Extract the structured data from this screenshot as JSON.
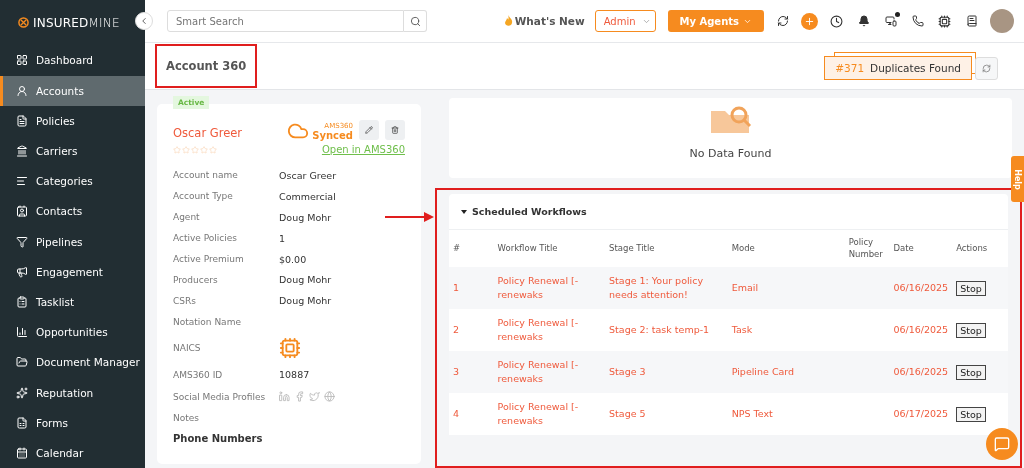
{
  "brand": {
    "logo": "**INSURED**MINE"
  },
  "sidebar": {
    "items": [
      {
        "label": "Dashboard",
        "selected": false
      },
      {
        "label": "Accounts",
        "selected": true
      },
      {
        "label": "Policies",
        "selected": false
      },
      {
        "label": "Carriers",
        "selected": false
      },
      {
        "label": "Categories",
        "selected": false
      },
      {
        "label": "Contacts",
        "selected": false
      },
      {
        "label": "Pipelines",
        "selected": false
      },
      {
        "label": "Engagement",
        "selected": false
      },
      {
        "label": "Tasklist",
        "selected": false
      },
      {
        "label": "Opportunities",
        "selected": false
      },
      {
        "label": "Document Manager",
        "selected": false
      },
      {
        "label": "Reputation",
        "selected": false
      },
      {
        "label": "Forms",
        "selected": false
      },
      {
        "label": "Calendar",
        "selected": false
      }
    ]
  },
  "topbar": {
    "search_placeholder": "Smart Search",
    "whats_new": "What's New",
    "role": "Admin",
    "agents_button": "My Agents"
  },
  "page": {
    "title": "Account 360",
    "duplicates_count": "#371",
    "duplicates_label": "Duplicates Found"
  },
  "account": {
    "status": "Active",
    "name": "Oscar Greer",
    "stars": 0,
    "sync_source": "AMS360",
    "sync_status": "Synced",
    "open_link": "Open in AMS360",
    "fields": [
      {
        "label": "Account name",
        "value": "Oscar Greer",
        "kind": "text"
      },
      {
        "label": "Account Type",
        "value": "Commercial",
        "kind": "text"
      },
      {
        "label": "Agent",
        "value": "Doug Mohr",
        "kind": "text"
      },
      {
        "label": "Active Policies",
        "value": "1",
        "kind": "text"
      },
      {
        "label": "Active Premium",
        "value": "$0.00",
        "kind": "text"
      },
      {
        "label": "Producers",
        "value": "Doug Mohr",
        "kind": "text"
      },
      {
        "label": "CSRs",
        "value": "Doug Mohr",
        "kind": "text"
      },
      {
        "label": "Notation Name",
        "kind": "text"
      },
      {
        "label": "NAICS",
        "kind": "ai"
      },
      {
        "label": "AMS360 ID",
        "value": "10887",
        "kind": "text"
      },
      {
        "label": "Social Media Profiles",
        "kind": "social"
      },
      {
        "label": "Notes",
        "kind": "text"
      }
    ],
    "section": "Phone Numbers"
  },
  "empty_panel": {
    "message": "No Data Found"
  },
  "workflows": {
    "title": "Scheduled Workflows",
    "expanded": true,
    "columns": [
      "#",
      "Workflow Title",
      "Stage Title",
      "Mode",
      "Policy Number",
      "Date",
      "Actions"
    ],
    "rows": [
      {
        "num": "1",
        "workflow": "Policy Renewal [-renewaks",
        "stage": "Stage 1: Your policy needs attention!",
        "mode": "Email",
        "date": "06/16/2025",
        "action": "Stop"
      },
      {
        "num": "2",
        "workflow": "Policy Renewal [-renewaks",
        "stage": "Stage 2: task temp-1",
        "mode": "Task",
        "date": "06/16/2025",
        "action": "Stop"
      },
      {
        "num": "3",
        "workflow": "Policy Renewal [-renewaks",
        "stage": "Stage 3",
        "mode": "Pipeline Card",
        "date": "06/16/2025",
        "action": "Stop"
      },
      {
        "num": "4",
        "workflow": "Policy Renewal [-renewaks",
        "stage": "Stage 5",
        "mode": "NPS Text",
        "date": "06/17/2025",
        "action": "Stop"
      }
    ]
  },
  "help_tab": "Help"
}
